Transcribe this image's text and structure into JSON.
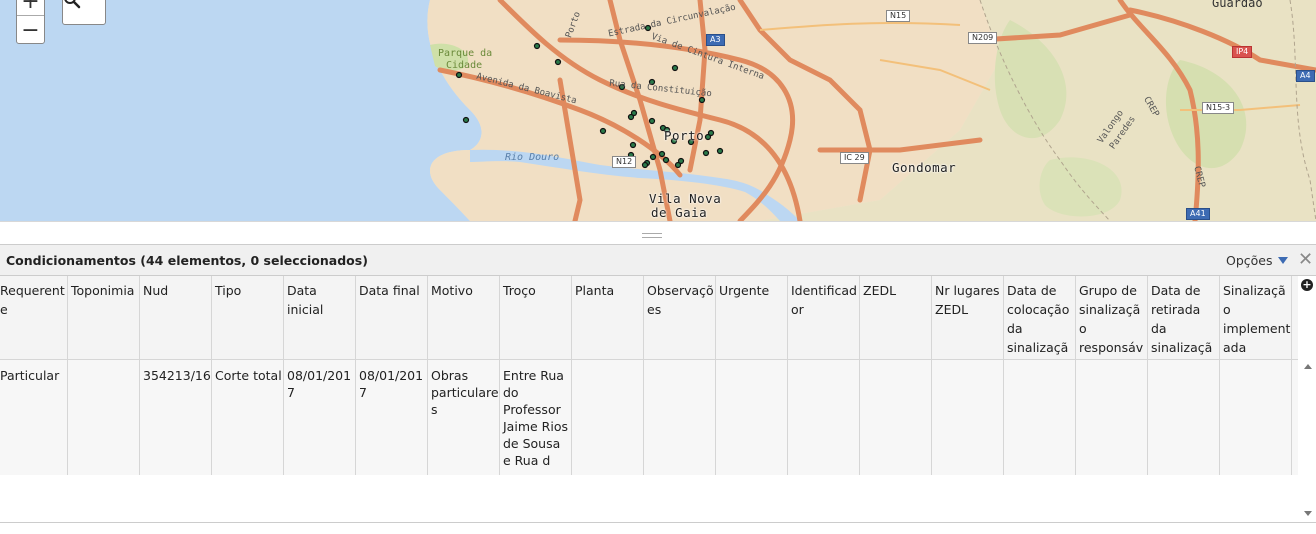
{
  "map": {
    "labels": {
      "guardao": "Guardão",
      "porto": "Porto",
      "gondomar": "Gondomar",
      "vila_nova_de_gaia_1": "Vila Nova",
      "vila_nova_de_gaia_2": "de Gaia",
      "parque_cidade_1": "Parque da",
      "parque_cidade_2": "Cidade",
      "rio_douro": "Rio Douro",
      "estrada_circunvalacao": "Estrada da Circunvalação",
      "via_cintura_interna": "Via de Cintura Interna",
      "avenida_boavista": "Avenida da Boavista",
      "rua_constituicao": "Rua da Constituição",
      "porto_small": "Porto",
      "valongo": "Valongo",
      "paredes": "Paredes",
      "crep1": "CREP",
      "crep2": "CREP"
    },
    "shields": {
      "a3": "A3",
      "n15": "N15",
      "n209": "N209",
      "ip4": "IP4",
      "a4": "A4",
      "n15_3": "N15-3",
      "ic29": "IC 29",
      "n12": "N12",
      "a41": "A41"
    },
    "zoom_in": "+",
    "zoom_out": "−"
  },
  "panel": {
    "title": "Condicionamentos (44 elementos, 0 seleccionados)",
    "options_label": "Opções"
  },
  "table": {
    "headers": [
      "Requerente",
      "Toponimia",
      "Nud",
      "Tipo",
      "Data inicial",
      "Data final",
      "Motivo",
      "Troço",
      "Planta",
      "Observações",
      "Urgente",
      "Identificador",
      "ZEDL",
      "Nr lugares ZEDL",
      "Data de colocação da sinalização",
      "Grupo de sinalização responsável",
      "Data de retirada da sinalização",
      "Sinalização implementada"
    ],
    "rows": [
      [
        "Particular",
        "",
        "354213/16",
        "Corte total",
        "08/01/2017",
        "08/01/2017",
        "Obras particulares",
        "Entre Rua do Professor Jaime Rios de Sousa e Rua d",
        "",
        "",
        "",
        "",
        "",
        "",
        "",
        "",
        "",
        ""
      ]
    ]
  },
  "colors": {
    "water": "#bcd7f2",
    "land": "#efe6d2",
    "road": "#e08a5e",
    "marker": "#2a7a4a"
  }
}
